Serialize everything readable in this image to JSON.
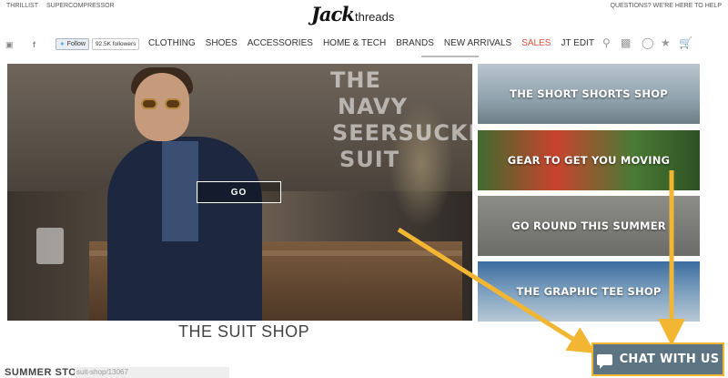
{
  "topbar": {
    "left_links": [
      "THRILLIST",
      "SUPERCOMPRESSOR"
    ],
    "right_text": "QUESTIONS? WE'RE HERE TO HELP"
  },
  "logo": {
    "script": "Jack",
    "word": "threads"
  },
  "social": {
    "follow_label": "Follow",
    "followers": "92.5K followers"
  },
  "menu": [
    {
      "label": "CLOTHING"
    },
    {
      "label": "SHOES"
    },
    {
      "label": "ACCESSORIES"
    },
    {
      "label": "HOME & TECH"
    },
    {
      "label": "BRANDS"
    },
    {
      "label": "NEW ARRIVALS"
    },
    {
      "label": "SALES"
    },
    {
      "label": "JT EDIT"
    }
  ],
  "hero": {
    "title_lines": [
      "THE",
      "NAVY",
      "SEERSUCKER",
      "SUIT"
    ],
    "button": "GO",
    "caption": "THE SUIT SHOP"
  },
  "tiles": [
    {
      "label": "THE SHORT SHORTS SHOP"
    },
    {
      "label": "GEAR TO GET YOU MOVING"
    },
    {
      "label": "GO ROUND THIS SUMMER"
    },
    {
      "label": "THE GRAPHIC TEE SHOP"
    }
  ],
  "chat": {
    "label": "CHAT WITH US"
  },
  "bottom": {
    "section_title": "SUMMER STOCK-UP",
    "url_hint": "suit-shop/13067"
  },
  "colors": {
    "sale": "#e0523a",
    "chat_bg": "#5d7482",
    "highlight": "#f2b632"
  }
}
